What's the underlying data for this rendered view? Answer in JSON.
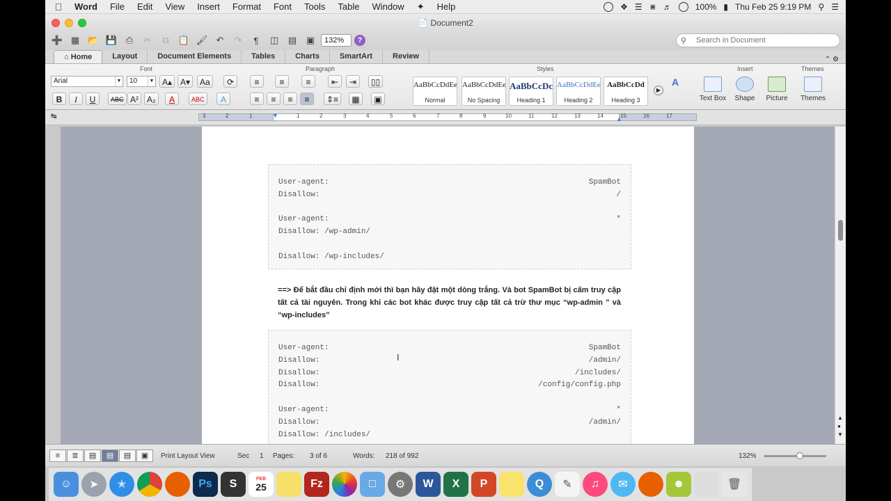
{
  "menubar": {
    "app": "Word",
    "items": [
      "File",
      "Edit",
      "View",
      "Insert",
      "Format",
      "Font",
      "Tools",
      "Table",
      "Window",
      "Help"
    ],
    "battery": "100%",
    "datetime": "Thu Feb 25  9:19 PM"
  },
  "window": {
    "title": "Document2"
  },
  "toolbar": {
    "zoom": "132%",
    "search_placeholder": "Search in Document"
  },
  "ribbon": {
    "tabs": [
      "Home",
      "Layout",
      "Document Elements",
      "Tables",
      "Charts",
      "SmartArt",
      "Review"
    ],
    "groups": {
      "font": "Font",
      "paragraph": "Paragraph",
      "styles": "Styles",
      "insert": "Insert",
      "themes": "Themes"
    },
    "font_name": "Arial",
    "font_size": "10",
    "styles": [
      {
        "sample": "AaBbCcDdEe",
        "name": "Normal"
      },
      {
        "sample": "AaBbCcDdEe",
        "name": "No Spacing"
      },
      {
        "sample": "AaBbCcDc",
        "name": "Heading 1"
      },
      {
        "sample": "AaBbCcDdEe",
        "name": "Heading 2"
      },
      {
        "sample": "AaBbCcDd",
        "name": "Heading 3"
      }
    ],
    "insert_buttons": [
      "Text Box",
      "Shape",
      "Picture"
    ],
    "themes_button": "Themes"
  },
  "ruler": {
    "numbers": [
      "3",
      "2",
      "1",
      "1",
      "2",
      "3",
      "4",
      "5",
      "6",
      "7",
      "8",
      "9",
      "10",
      "11",
      "12",
      "13",
      "14",
      "15",
      "16",
      "17"
    ]
  },
  "document": {
    "block1": [
      [
        "User-agent:",
        "SpamBot"
      ],
      [
        "Disallow:",
        "/"
      ],
      [
        "",
        ""
      ],
      [
        "User-agent:",
        "*"
      ],
      [
        "Disallow: /wp-admin/",
        ""
      ],
      [
        "",
        ""
      ],
      [
        "Disallow: /wp-includes/",
        ""
      ]
    ],
    "paragraph": "==> Để bắt đầu chỉ định mới thì bạn hãy đặt một dòng trắng. Và bot SpamBot bị cấm truy cập tất cả tài nguyên. Trong khi các bot khác  được truy cập tất cả trừ thư mục “wp-admin ” và “wp-includes”",
    "block2": [
      [
        "User-agent:",
        "SpamBot"
      ],
      [
        "Disallow:",
        "/admin/"
      ],
      [
        "Disallow:",
        "/includes/"
      ],
      [
        "Disallow:",
        "/config/config.php"
      ],
      [
        "",
        ""
      ],
      [
        "User-agent:",
        "*"
      ],
      [
        "Disallow:",
        "/admin/"
      ],
      [
        "Disallow: /includes/",
        ""
      ]
    ]
  },
  "statusbar": {
    "view": "Print Layout View",
    "sec_label": "Sec",
    "sec_value": "1",
    "pages_label": "Pages:",
    "pages_value": "3 of 6",
    "words_label": "Words:",
    "words_value": "218 of 992",
    "zoom": "132%"
  },
  "dock": {
    "calendar_month": "FEB",
    "calendar_day": "25",
    "apps": [
      "Finder",
      "Launchpad",
      "Safari",
      "Chrome",
      "Firefox",
      "Photoshop",
      "Sublime",
      "Calendar",
      "Notes",
      "FileZilla",
      "Photos",
      "Keynote",
      "System Preferences",
      "Word",
      "Excel",
      "PowerPoint",
      "Stickies",
      "QuickTime",
      "TextEdit",
      "iTunes",
      "Messages",
      "Firefox Dev",
      "Android",
      "Preview",
      "Trash"
    ]
  },
  "colors": {
    "accent": "#6f7f99",
    "page_bg": "#a4a9b5"
  }
}
